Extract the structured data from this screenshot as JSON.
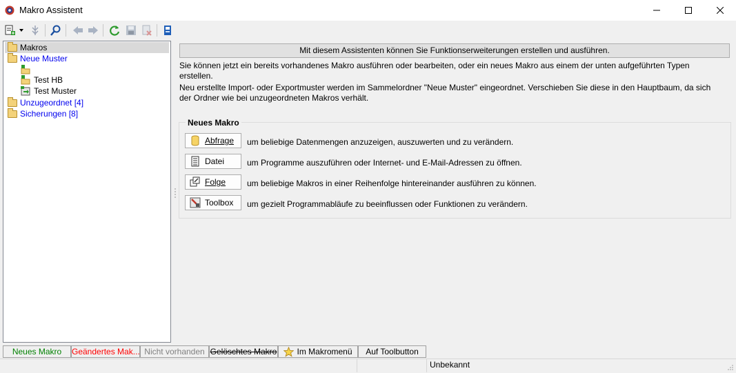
{
  "window": {
    "title": "Makro Assistent",
    "icon": "gear-icon",
    "controls": [
      "minimize",
      "maximize",
      "close"
    ]
  },
  "toolbar": {
    "buttons": [
      {
        "name": "new-macro-dropdown",
        "icon": "new-document-icon"
      },
      {
        "name": "pin",
        "icon": "pin-icon"
      },
      {
        "name": "search",
        "icon": "search-icon"
      },
      {
        "name": "back",
        "icon": "arrow-left-icon"
      },
      {
        "name": "forward",
        "icon": "arrow-right-icon"
      },
      {
        "name": "refresh",
        "icon": "refresh-icon"
      },
      {
        "name": "save",
        "icon": "save-icon"
      },
      {
        "name": "delete",
        "icon": "delete-icon"
      },
      {
        "name": "properties",
        "icon": "panel-icon"
      }
    ]
  },
  "tree": {
    "root": "Makros",
    "items": [
      {
        "label": "Neue Muster",
        "color": "#0000ee"
      },
      {
        "label": ""
      },
      {
        "label": "Test HB"
      },
      {
        "label": "Test Muster"
      },
      {
        "label": "Unzugeordnet [4]",
        "color": "#0000ee"
      },
      {
        "label": "Sicherungen [8]",
        "color": "#0000ee"
      }
    ]
  },
  "main": {
    "banner": "Mit diesem Assistenten können Sie Funktionserweiterungen erstellen und ausführen.",
    "intro": "Sie können jetzt ein bereits vorhandenes Makro ausführen oder bearbeiten, oder ein neues Makro aus einem der unten aufgeführten Typen erstellen.",
    "note": "Neu erstellte Import- oder Exportmuster werden im Sammelordner \"Neue Muster\" eingeordnet. Verschieben Sie diese in den Hauptbaum, da sich der Ordner wie bei unzugeordneten Makros verhält.",
    "group_title": "Neues Makro",
    "macro_types": [
      {
        "label": "Abfrage",
        "icon": "database-icon",
        "description": "um beliebige Datenmengen anzuzeigen, auszuwerten und zu verändern."
      },
      {
        "label": "Datei",
        "icon": "document-icon",
        "description": "um Programme auszuführen oder Internet- und E-Mail-Adressen zu öffnen."
      },
      {
        "label": "Folge",
        "icon": "sequence-icon",
        "description": "um beliebige Makros in einer Reihenfolge hintereinander ausführen zu können."
      },
      {
        "label": "Toolbox",
        "icon": "toolbox-icon",
        "description": "um gezielt Programmabläufe zu beeinflussen oder Funktionen zu verändern."
      }
    ]
  },
  "legend": {
    "items": [
      {
        "label": "Neues Makro",
        "color": "#008000"
      },
      {
        "label": "Geändertes Mak...",
        "color": "#ff0000"
      },
      {
        "label": "Nicht vorhanden",
        "color": "#808080"
      },
      {
        "label": "Gelöschtes Makro",
        "color": "#000000",
        "strike": true
      },
      {
        "label": "Im Makromenü",
        "icon": "star-icon"
      },
      {
        "label": "Auf Toolbutton"
      }
    ]
  },
  "status": {
    "cell2": "Unbekannt"
  }
}
